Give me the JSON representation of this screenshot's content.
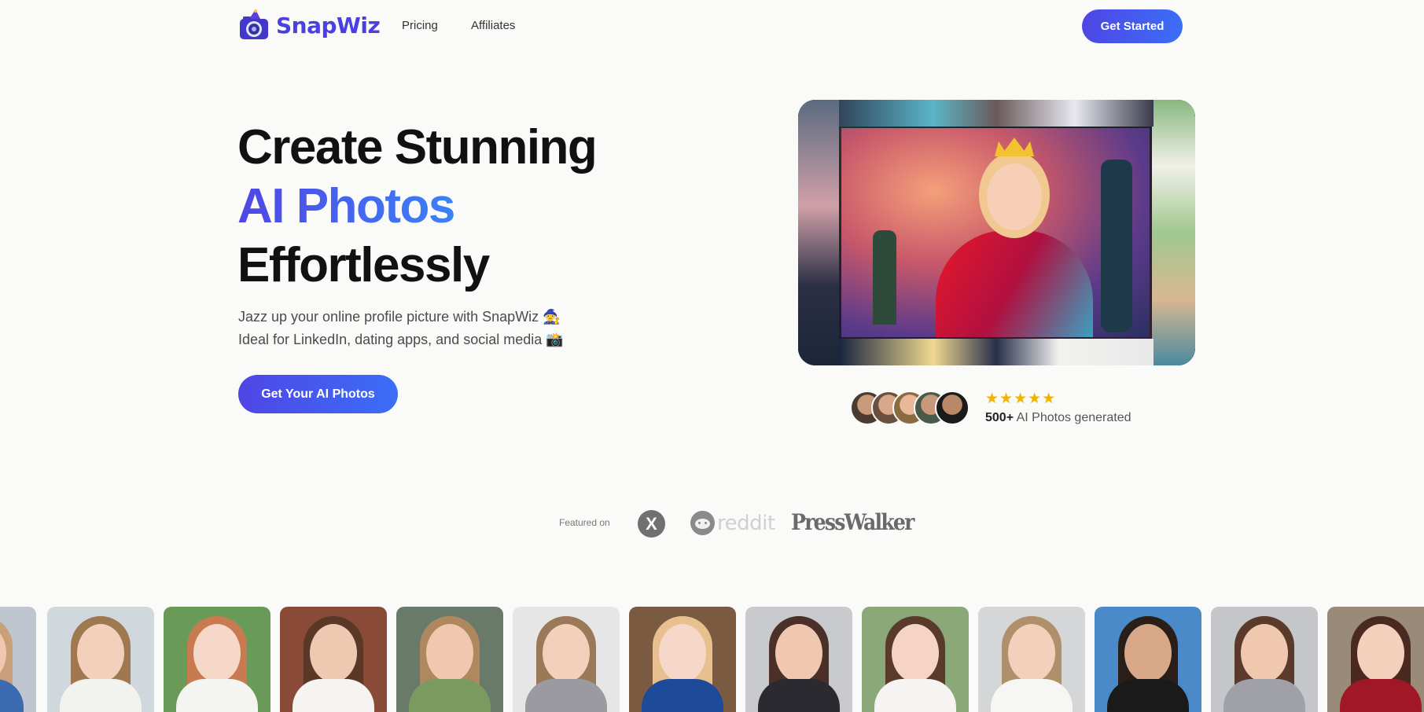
{
  "nav": {
    "brand": "SnapWiz",
    "links": [
      "Pricing",
      "Affiliates"
    ],
    "cta": "Get Started"
  },
  "hero": {
    "title_line1": "Create Stunning",
    "title_accent": "AI Photos",
    "title_line3": "Effortlessly",
    "subtitle_line1": "Jazz up your online profile picture with SnapWiz 🧙",
    "subtitle_line2": "Ideal for LinkedIn, dating apps, and social media 📸",
    "cta": "Get Your AI Photos"
  },
  "proof": {
    "stars": "★★★★★",
    "count": "500+",
    "text": "AI Photos generated"
  },
  "featured": {
    "label": "Featured on",
    "outlets": [
      "X",
      "reddit",
      "PressWalker"
    ]
  },
  "colors": {
    "accent": "#4f46e5",
    "accent2": "#3b82f6",
    "background": "#fafaf8",
    "star": "#f0b400"
  }
}
